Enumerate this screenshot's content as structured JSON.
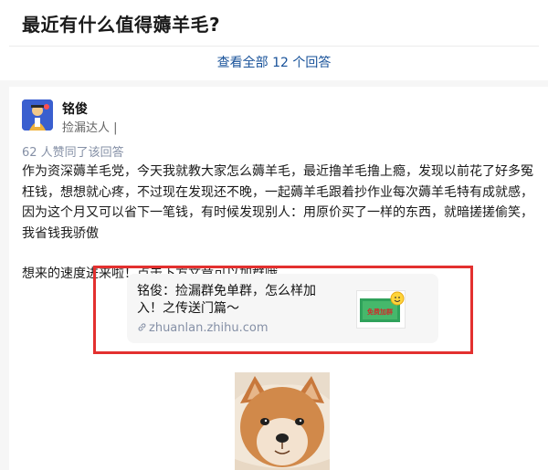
{
  "question": {
    "title": "最近有什么值得薅羊毛?",
    "view_all": "查看全部 12 个回答"
  },
  "answer": {
    "author": "铭俊",
    "tagline": "捡漏达人 |",
    "votes": "62 人赞同了该回答",
    "paragraph1": "作为资深薅羊毛党，今天我就教大家怎么薅羊毛，最近撸羊毛撸上瘾，发现以前花了好多冤枉钱，想想就心疼，不过现在发现还不晚，一起薅羊毛跟着抄作业每次薅羊毛特有成就感，因为这个月又可以省下一笔钱，有时候发现别人：用原价买了一样的东西，就暗搓搓偷笑，我省钱我骄傲",
    "paragraph2": "想来的速度进来啦！点击下方文章可以加群哦",
    "link_card": {
      "title": "铭俊：捡漏群免单群，怎么样加入！之传送门篇～",
      "url": "zhuanlan.zhihu.com",
      "thumbnail_text": "免费加群"
    }
  },
  "colors": {
    "link_blue": "#175199",
    "highlight_red": "#e3302f",
    "meta_gray": "#8590a6"
  }
}
